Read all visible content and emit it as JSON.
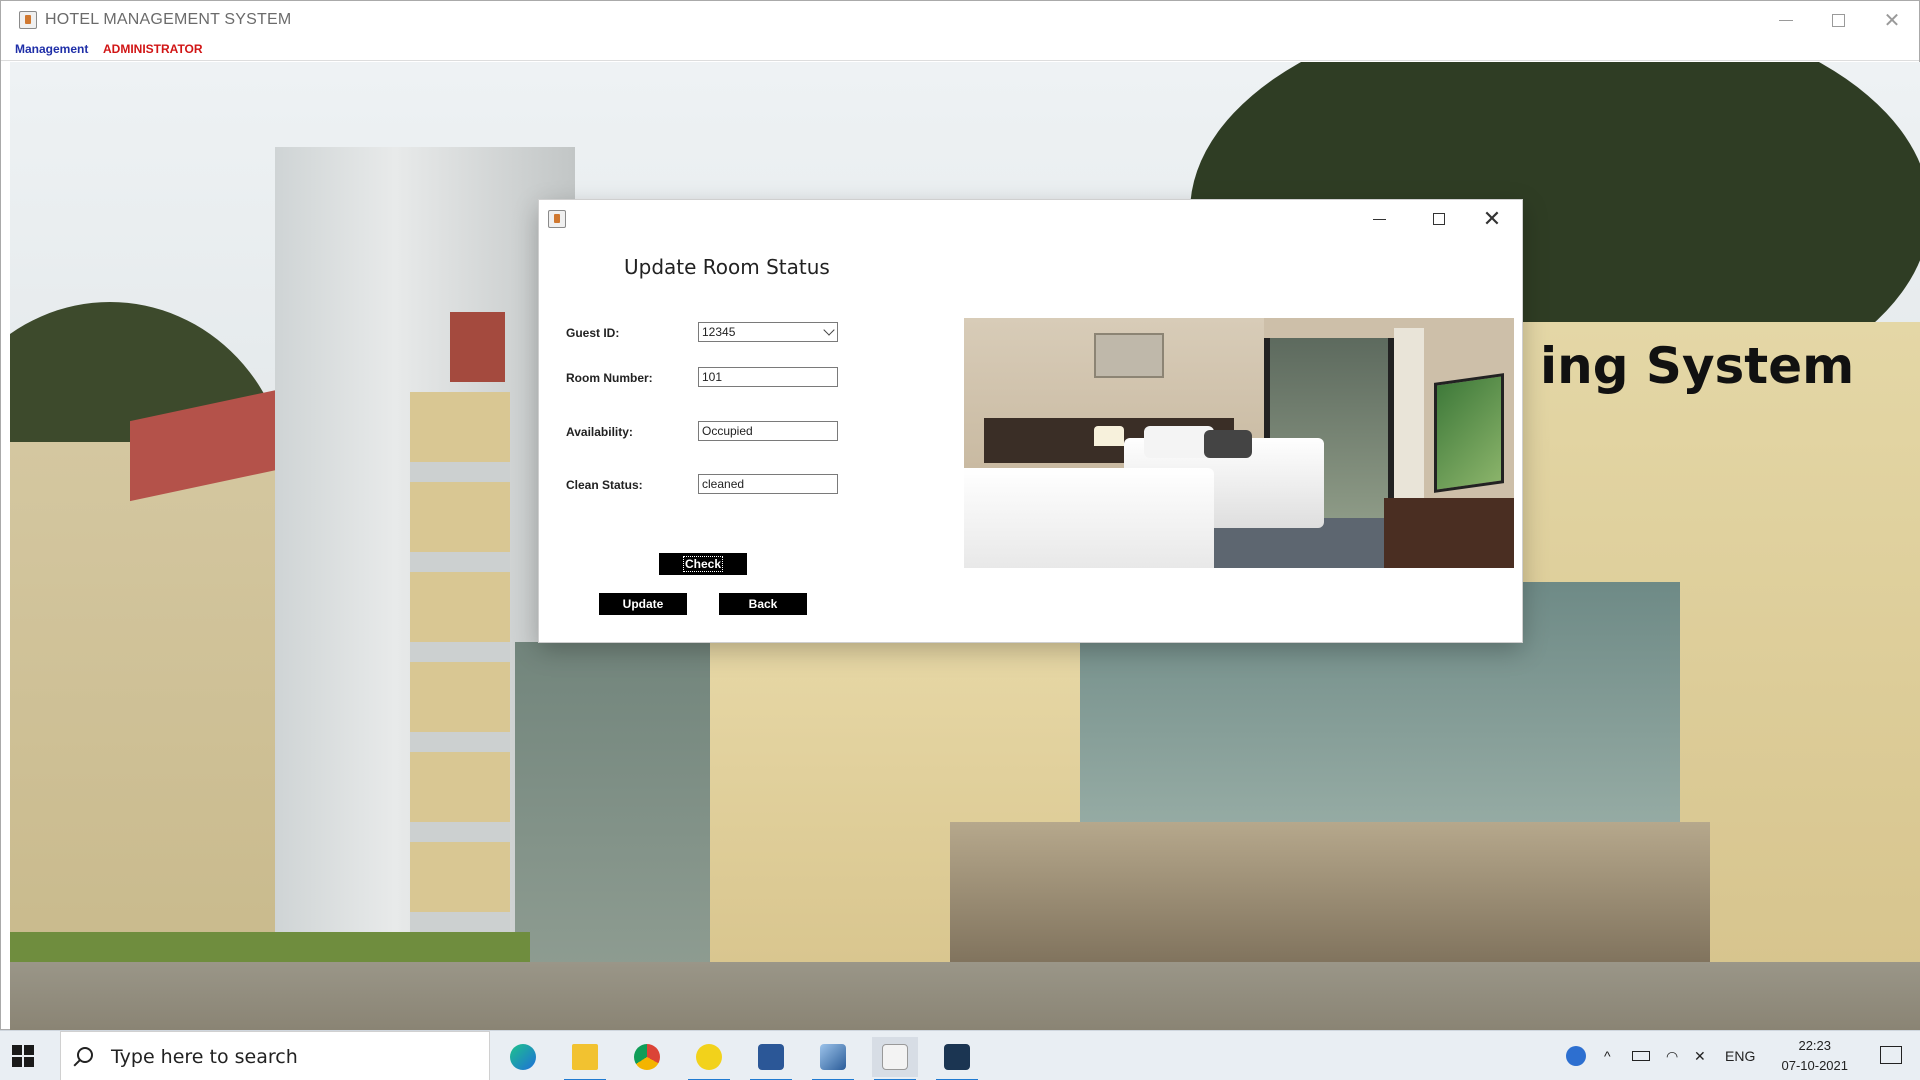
{
  "window": {
    "title": "HOTEL MANAGEMENT SYSTEM",
    "menu": [
      "Management",
      "ADMINISTRATOR"
    ],
    "background_heading": "ing System"
  },
  "dialog": {
    "title": "Update Room Status",
    "fields": {
      "guest_id_label": "Guest ID:",
      "guest_id_value": "12345",
      "room_number_label": "Room Number:",
      "room_number_value": "101",
      "availability_label": "Availability:",
      "availability_value": "Occupied",
      "clean_status_label": "Clean Status:",
      "clean_status_value": "cleaned"
    },
    "buttons": {
      "check": "Check",
      "update": "Update",
      "back": "Back"
    }
  },
  "taskbar": {
    "search_placeholder": "Type here to search",
    "apps": [
      "edge-icon",
      "file-explorer-icon",
      "chrome-icon",
      "pdf-icon",
      "word-icon",
      "virtualbox-icon",
      "java-icon",
      "mysql-icon"
    ],
    "language": "ENG",
    "time": "22:23",
    "date": "07-10-2021"
  },
  "colors": {
    "menu_management": "#1f2fa8",
    "menu_admin": "#d11515",
    "button_bg": "#000000",
    "button_fg": "#ffffff"
  }
}
